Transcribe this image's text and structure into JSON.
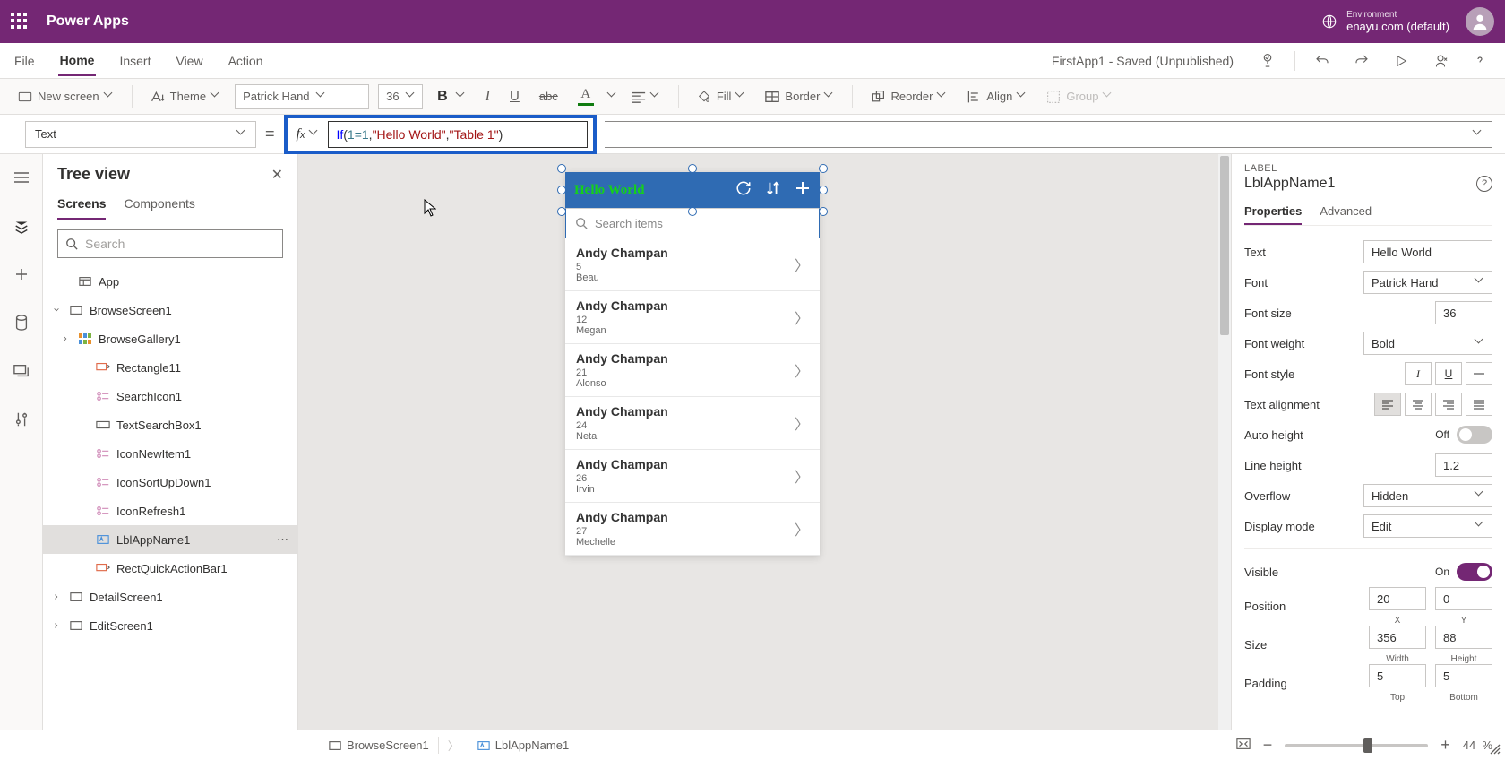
{
  "titlebar": {
    "app": "Power Apps",
    "env_label": "Environment",
    "env_name": "enayu.com (default)"
  },
  "menu": {
    "items": [
      "File",
      "Home",
      "Insert",
      "View",
      "Action"
    ],
    "active": "Home",
    "status": "FirstApp1 - Saved (Unpublished)"
  },
  "ribbon": {
    "new_screen": "New screen",
    "theme": "Theme",
    "font": "Patrick Hand",
    "size": "36",
    "fill": "Fill",
    "border": "Border",
    "reorder": "Reorder",
    "align": "Align",
    "group": "Group"
  },
  "formula": {
    "property": "Text",
    "expr_kw": "If",
    "expr_cond": "1=1",
    "expr_true": "\"Hello World\"",
    "expr_false": "\"Table 1\""
  },
  "tree": {
    "title": "Tree view",
    "tabs": [
      "Screens",
      "Components"
    ],
    "search_placeholder": "Search",
    "app": "App",
    "nodes": {
      "browse_screen": "BrowseScreen1",
      "gallery": "BrowseGallery1",
      "rect11": "Rectangle11",
      "searchicon": "SearchIcon1",
      "textsearch": "TextSearchBox1",
      "iconnew": "IconNewItem1",
      "iconsort": "IconSortUpDown1",
      "iconrefresh": "IconRefresh1",
      "lblappname": "LblAppName1",
      "rectquick": "RectQuickActionBar1",
      "detail": "DetailScreen1",
      "edit": "EditScreen1"
    }
  },
  "canvas": {
    "header_text": "Hello World",
    "search_placeholder": "Search items",
    "items": [
      {
        "title": "Andy Champan",
        "sub": "5",
        "sub2": "Beau"
      },
      {
        "title": "Andy Champan",
        "sub": "12",
        "sub2": "Megan"
      },
      {
        "title": "Andy Champan",
        "sub": "21",
        "sub2": "Alonso"
      },
      {
        "title": "Andy Champan",
        "sub": "24",
        "sub2": "Neta"
      },
      {
        "title": "Andy Champan",
        "sub": "26",
        "sub2": "Irvin"
      },
      {
        "title": "Andy Champan",
        "sub": "27",
        "sub2": "Mechelle"
      }
    ]
  },
  "props": {
    "type_label": "LABEL",
    "name": "LblAppName1",
    "tabs": [
      "Properties",
      "Advanced"
    ],
    "text_label": "Text",
    "text_value": "Hello World",
    "font_label": "Font",
    "font_value": "Patrick Hand",
    "fontsize_label": "Font size",
    "fontsize_value": "36",
    "fontweight_label": "Font weight",
    "fontweight_value": "Bold",
    "fontstyle_label": "Font style",
    "textalign_label": "Text alignment",
    "autoheight_label": "Auto height",
    "autoheight_value": "Off",
    "lineheight_label": "Line height",
    "lineheight_value": "1.2",
    "overflow_label": "Overflow",
    "overflow_value": "Hidden",
    "displaymode_label": "Display mode",
    "displaymode_value": "Edit",
    "visible_label": "Visible",
    "visible_value": "On",
    "position_label": "Position",
    "pos_x": "20",
    "pos_y": "0",
    "pos_xl": "X",
    "pos_yl": "Y",
    "size_label": "Size",
    "size_w": "356",
    "size_h": "88",
    "size_wl": "Width",
    "size_hl": "Height",
    "padding_label": "Padding",
    "pad_t": "5",
    "pad_b": "5",
    "pad_tl": "Top",
    "pad_bl": "Bottom"
  },
  "status": {
    "crumb1": "BrowseScreen1",
    "crumb2": "LblAppName1",
    "zoom": "44",
    "zoom_pct": "%"
  }
}
